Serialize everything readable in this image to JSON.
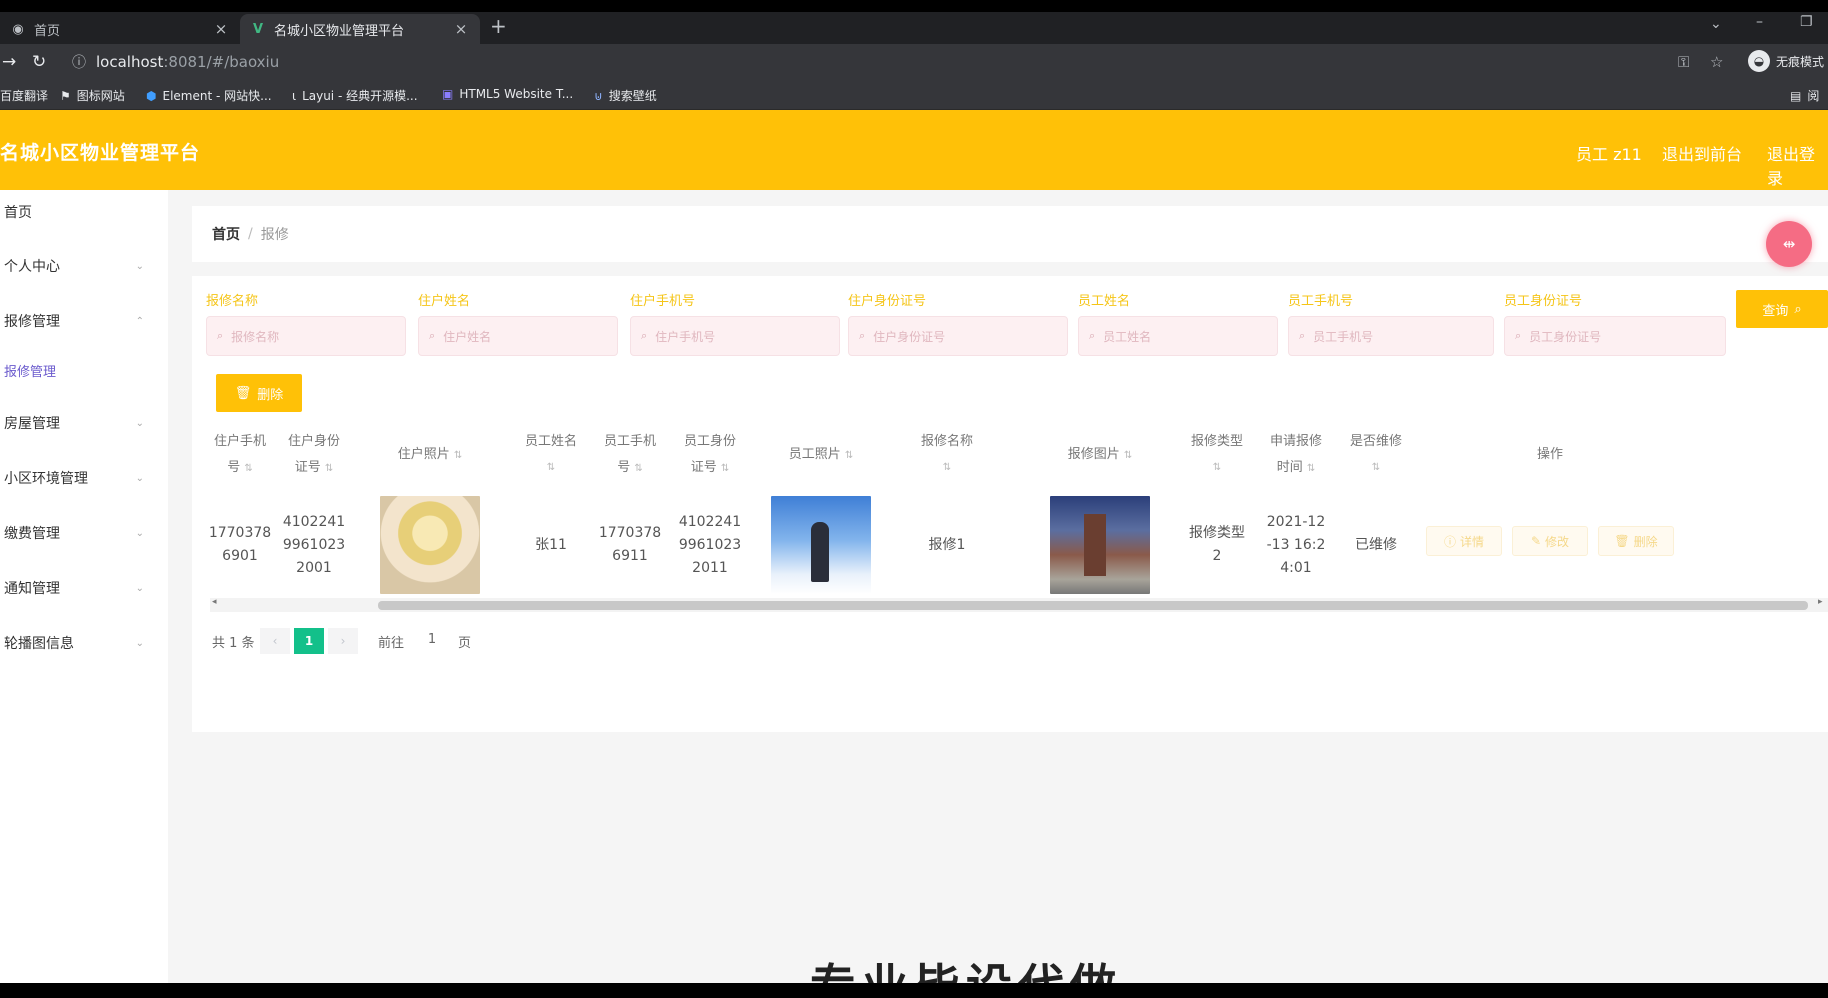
{
  "browser": {
    "tabs": [
      {
        "title": "首页",
        "active": false
      },
      {
        "title": "名城小区物业管理平台",
        "active": true
      }
    ],
    "url_host": "localhost",
    "url_rest": ":8081/#/baoxiu",
    "incognito_label": "无痕模式",
    "bookmarks": [
      "百度翻译",
      "图标网站",
      "Element - 网站快...",
      "Layui - 经典开源模...",
      "HTML5 Website T...",
      "搜索壁纸"
    ],
    "bookmarks_right": "阅"
  },
  "header": {
    "title": "名城小区物业管理平台",
    "links": [
      "员工 z11",
      "退出到前台",
      "退出登录"
    ]
  },
  "sidebar": {
    "items": [
      {
        "label": "首页",
        "has_arrow": false
      },
      {
        "label": "个人中心",
        "has_arrow": true
      },
      {
        "label": "报修管理",
        "has_arrow": true
      },
      {
        "label": "报修管理",
        "has_arrow": false,
        "active": true
      },
      {
        "label": "房屋管理",
        "has_arrow": true
      },
      {
        "label": "小区环境管理",
        "has_arrow": true
      },
      {
        "label": "缴费管理",
        "has_arrow": true
      },
      {
        "label": "通知管理",
        "has_arrow": true
      },
      {
        "label": "轮播图信息",
        "has_arrow": true
      }
    ]
  },
  "breadcrumb": {
    "home": "首页",
    "separator": "/",
    "current": "报修"
  },
  "filters": [
    {
      "label": "报修名称",
      "placeholder": "报修名称"
    },
    {
      "label": "住户姓名",
      "placeholder": "住户姓名"
    },
    {
      "label": "住户手机号",
      "placeholder": "住户手机号"
    },
    {
      "label": "住户身份证号",
      "placeholder": "住户身份证号"
    },
    {
      "label": "员工姓名",
      "placeholder": "员工姓名"
    },
    {
      "label": "员工手机号",
      "placeholder": "员工手机号"
    },
    {
      "label": "员工身份证号",
      "placeholder": "员工身份证号"
    }
  ],
  "buttons": {
    "search": "查询",
    "delete": "删除"
  },
  "table": {
    "headers": [
      [
        "住户手机",
        "号"
      ],
      [
        "住户身份",
        "证号"
      ],
      [
        "住户照片"
      ],
      [
        "员工姓名",
        ""
      ],
      [
        "员工手机",
        "号"
      ],
      [
        "员工身份",
        "证号"
      ],
      [
        "员工照片"
      ],
      [
        "报修名称",
        ""
      ],
      [
        "报修图片"
      ],
      [
        "报修类型",
        ""
      ],
      [
        "申请报修",
        "时间"
      ],
      [
        "是否维修",
        ""
      ],
      [
        "操作"
      ]
    ],
    "row": {
      "resident_phone": [
        "1770378",
        "6901"
      ],
      "resident_id": [
        "4102241",
        "9961023",
        "2001"
      ],
      "staff_name": "张11",
      "staff_phone": [
        "1770378",
        "6911"
      ],
      "staff_id": [
        "4102241",
        "9961023",
        "2011"
      ],
      "repair_name": "报修1",
      "repair_type": [
        "报修类型",
        "2"
      ],
      "apply_time": [
        "2021-12",
        "-13 16:2",
        "4:01"
      ],
      "is_repaired": "已维修",
      "actions": [
        "详情",
        "修改",
        "删除"
      ]
    }
  },
  "pagination": {
    "total": "共 1 条",
    "prev": "‹",
    "current": "1",
    "next": "›",
    "goto": "前往",
    "page_input": "1",
    "page_unit": "页"
  },
  "watermark": "专业毕设代做",
  "colors": {
    "header": "#ffc107",
    "accent_pink": "#f56c84",
    "page_active": "#13c08a",
    "active_menu": "#6a5acd"
  }
}
